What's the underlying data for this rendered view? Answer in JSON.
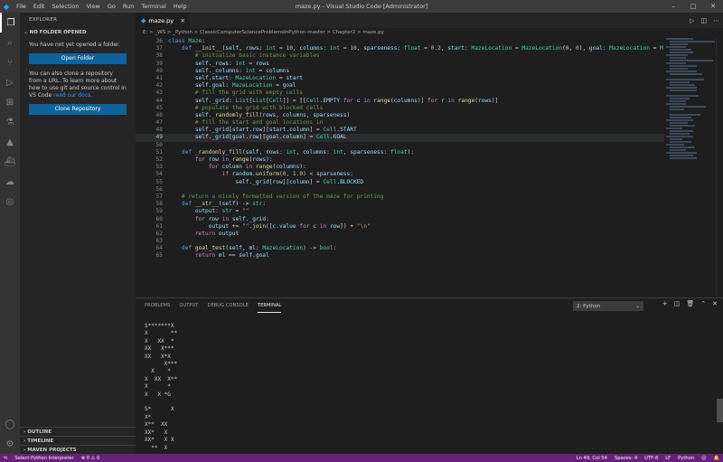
{
  "window": {
    "title": "maze.py - Visual Studio Code [Administrator]",
    "menu": [
      "File",
      "Edit",
      "Selection",
      "View",
      "Go",
      "Run",
      "Terminal",
      "Help"
    ]
  },
  "sidebar": {
    "header": "EXPLORER",
    "section": "NO FOLDER OPENED",
    "message1": "You have not yet opened a folder.",
    "open_folder": "Open Folder",
    "message2": "You can also clone a repository from a URL. To learn more about how to use git and source control in VS Code",
    "learn_link": "read our docs.",
    "clone_repo": "Clone Repository",
    "bottom": [
      "OUTLINE",
      "TIMELINE",
      "MAVEN PROJECTS"
    ]
  },
  "editor": {
    "tab": "maze.py",
    "breadcrumb": "E: > _WS > _Python > ClassicComputerScienceProblemsInPython-master > Chapter2 > maze.py"
  },
  "panel": {
    "tabs": [
      "PROBLEMS",
      "OUTPUT",
      "DEBUG CONSOLE",
      "TERMINAL"
    ],
    "terminal_select": "2: Python",
    "terminal_output": "S*******X\nX       **\nX   XX  *\nXX   X***\nXX   X*X\n      X***\n  X    *\nX  XX  X**\nX      *\nX   X *G\n\nS*      X\nX*\nX**  XX\nXX*   X\nXX*   X X\n  **  X"
  },
  "status": {
    "interpreter": "Select Python Interpreter",
    "errors": "0",
    "warnings": "0",
    "position": "Ln 49, Col 54",
    "spaces": "Spaces: 4",
    "encoding": "UTF-8",
    "eol": "LF",
    "language": "Python"
  }
}
